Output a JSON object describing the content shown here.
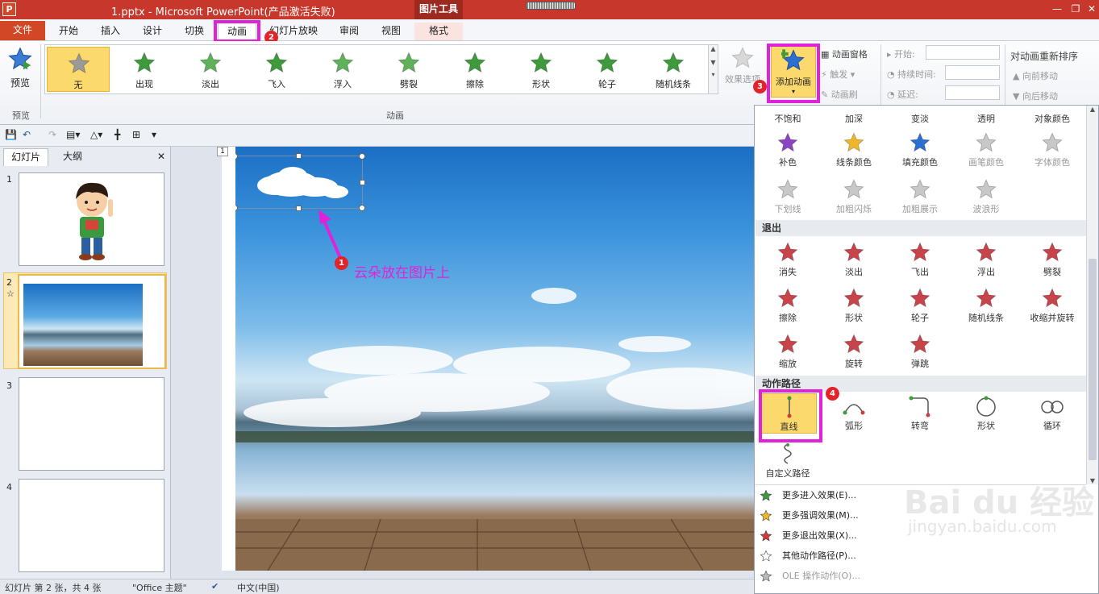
{
  "titlebar": {
    "app_icon": "P",
    "title": "1.pptx - Microsoft PowerPoint(产品激活失败)",
    "context_group": "图片工具",
    "minimize": "—",
    "restore": "❐",
    "close": "✕"
  },
  "tabs": [
    "文件",
    "开始",
    "插入",
    "设计",
    "切换",
    "动画",
    "幻灯片放映",
    "审阅",
    "视图",
    "格式"
  ],
  "badges": {
    "b1": "1",
    "b2": "2",
    "b3": "3",
    "b4": "4"
  },
  "ribbon": {
    "preview_label": "预览",
    "preview_group": "预览",
    "animation_group": "动画",
    "gallery": [
      {
        "label": "无",
        "color": "#9a9a9a"
      },
      {
        "label": "出现",
        "color": "#3e9a3a"
      },
      {
        "label": "淡出",
        "color": "#5fb25a"
      },
      {
        "label": "飞入",
        "color": "#3e9a3a"
      },
      {
        "label": "浮入",
        "color": "#5fb25a"
      },
      {
        "label": "劈裂",
        "color": "#5fb25a"
      },
      {
        "label": "擦除",
        "color": "#3e9a3a"
      },
      {
        "label": "形状",
        "color": "#3e9a3a"
      },
      {
        "label": "轮子",
        "color": "#3e9a3a"
      },
      {
        "label": "随机线条",
        "color": "#3e9a3a"
      }
    ],
    "effect_options": "效果选项",
    "add_animation": "添加动画",
    "animation_pane": "动画窗格",
    "trigger": "触发",
    "animation_painter": "动画刷",
    "start": "开始:",
    "duration": "持续时间:",
    "delay": "延迟:",
    "reorder_title": "对动画重新排序",
    "move_earlier": "向前移动",
    "move_later": "向后移动"
  },
  "qat": {
    "save": "💾",
    "undo": "↶",
    "redo": "↷"
  },
  "panel": {
    "tab_slides": "幻灯片",
    "tab_outline": "大纲",
    "close": "✕",
    "thumbs": [
      "1",
      "2",
      "3",
      "4"
    ],
    "anim_marker": "☆"
  },
  "slide": {
    "num": "1",
    "annotation": "云朵放在图片上"
  },
  "statusbar": {
    "slide_info": "幻灯片 第 2 张，共 4 张",
    "theme": "\"Office 主题\"",
    "language": "中文(中国)"
  },
  "dropdown": {
    "emphasis_row1": [
      {
        "label": "不饱和"
      },
      {
        "label": "加深"
      },
      {
        "label": "变淡"
      },
      {
        "label": "透明"
      },
      {
        "label": "对象颜色"
      }
    ],
    "emphasis_row2": [
      {
        "label": "补色",
        "color": "#8b44c2",
        "enabled": true
      },
      {
        "label": "线条颜色",
        "color": "#f0b62b",
        "enabled": true
      },
      {
        "label": "填充颜色",
        "color": "#2b6fd1",
        "enabled": true
      },
      {
        "label": "画笔颜色",
        "color": "#c8c8c8",
        "enabled": false
      },
      {
        "label": "字体颜色",
        "color": "#c8c8c8",
        "enabled": false
      }
    ],
    "emphasis_row3": [
      {
        "label": "下划线",
        "color": "#c8c8c8"
      },
      {
        "label": "加粗闪烁",
        "color": "#c8c8c8"
      },
      {
        "label": "加粗展示",
        "color": "#c8c8c8"
      },
      {
        "label": "波浪形",
        "color": "#c8c8c8"
      }
    ],
    "exit_head": "退出",
    "exit_row1": [
      {
        "label": "消失"
      },
      {
        "label": "淡出"
      },
      {
        "label": "飞出"
      },
      {
        "label": "浮出"
      },
      {
        "label": "劈裂"
      }
    ],
    "exit_row2": [
      {
        "label": "擦除"
      },
      {
        "label": "形状"
      },
      {
        "label": "轮子"
      },
      {
        "label": "随机线条"
      },
      {
        "label": "收缩并旋转"
      }
    ],
    "exit_row3": [
      {
        "label": "缩放"
      },
      {
        "label": "旋转"
      },
      {
        "label": "弹跳"
      }
    ],
    "exit_color": "#c9434b",
    "path_head": "动作路径",
    "paths": [
      {
        "label": "直线"
      },
      {
        "label": "弧形"
      },
      {
        "label": "转弯"
      },
      {
        "label": "形状"
      },
      {
        "label": "循环"
      }
    ],
    "custom_path": "自定义路径",
    "menu": [
      {
        "label": "更多进入效果(E)...",
        "icon_color": "#3e9a3a",
        "enabled": true
      },
      {
        "label": "更多强调效果(M)...",
        "icon_color": "#f0b62b",
        "enabled": true
      },
      {
        "label": "更多退出效果(X)...",
        "icon_color": "#d13b3b",
        "enabled": true
      },
      {
        "label": "其他动作路径(P)...",
        "icon_color": "#ffffff",
        "enabled": true
      },
      {
        "label": "OLE 操作动作(O)...",
        "icon_color": "#bbbbbb",
        "enabled": false
      }
    ]
  },
  "watermark": {
    "brand": "Bai du 经验",
    "url": "jingyan.baidu.com"
  },
  "colors": {
    "titlebar": "#c8372b",
    "file_tab": "#d24726",
    "highlight": "#e022d8",
    "selection": "#fcd96d"
  }
}
